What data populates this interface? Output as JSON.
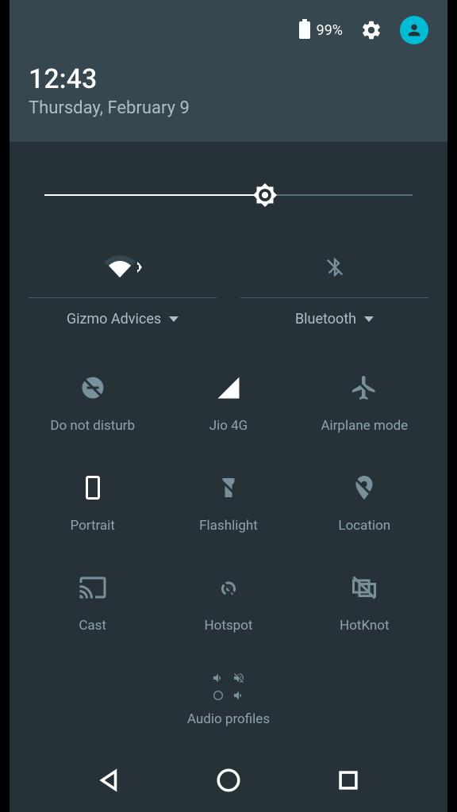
{
  "status": {
    "battery_percent": "99%",
    "time": "12:43",
    "date": "Thursday, February 9"
  },
  "brightness": {
    "percent": 60
  },
  "wide_tiles": {
    "wifi_label": "Gizmo Advices",
    "bluetooth_label": "Bluetooth"
  },
  "tiles": [
    {
      "label": "Do not disturb",
      "active": false,
      "icon": "dnd"
    },
    {
      "label": "Jio 4G",
      "active": true,
      "icon": "signal"
    },
    {
      "label": "Airplane mode",
      "active": false,
      "icon": "airplane"
    },
    {
      "label": "Portrait",
      "active": true,
      "icon": "portrait"
    },
    {
      "label": "Flashlight",
      "active": false,
      "icon": "flashlight"
    },
    {
      "label": "Location",
      "active": false,
      "icon": "location"
    },
    {
      "label": "Cast",
      "active": false,
      "icon": "cast"
    },
    {
      "label": "Hotspot",
      "active": false,
      "icon": "hotspot"
    },
    {
      "label": "HotKnot",
      "active": false,
      "icon": "hotknot"
    }
  ],
  "audio_label": "Audio profiles"
}
